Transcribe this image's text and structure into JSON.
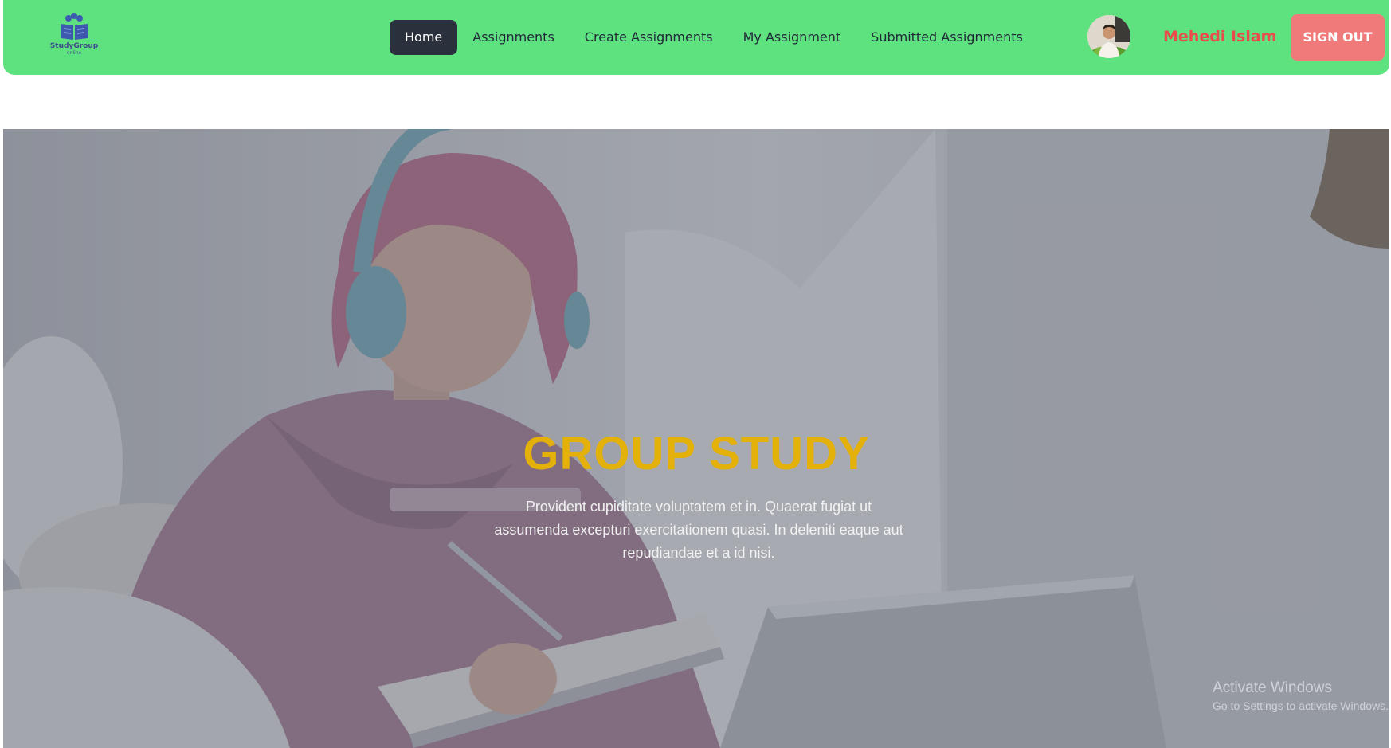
{
  "brand": {
    "logo_icon": "study-group-logo-icon",
    "name": "StudyGroup",
    "tagline": "online",
    "color": "#3d4d8a"
  },
  "nav": {
    "items": [
      {
        "label": "Home",
        "active": true
      },
      {
        "label": "Assignments",
        "active": false
      },
      {
        "label": "Create Assignments",
        "active": false
      },
      {
        "label": "My Assignment",
        "active": false
      },
      {
        "label": "Submitted Assignments",
        "active": false
      }
    ],
    "background_color": "#5ee17f",
    "active_color": "#2a303c"
  },
  "user": {
    "name": "Mehedi Islam",
    "name_color": "#ea4b4b",
    "signout_label": "SIGN OUT",
    "signout_color": "#f07a7a"
  },
  "hero": {
    "title": "GROUP STUDY",
    "title_color": "#e4b10a",
    "description": "Provident cupiditate voluptatem et in. Quaerat fugiat ut assumenda excepturi exercitationem quasi. In deleniti eaque aut repudiandae et a id nisi."
  },
  "watermark": {
    "title": "Activate Windows",
    "subtitle": "Go to Settings to activate Windows."
  }
}
